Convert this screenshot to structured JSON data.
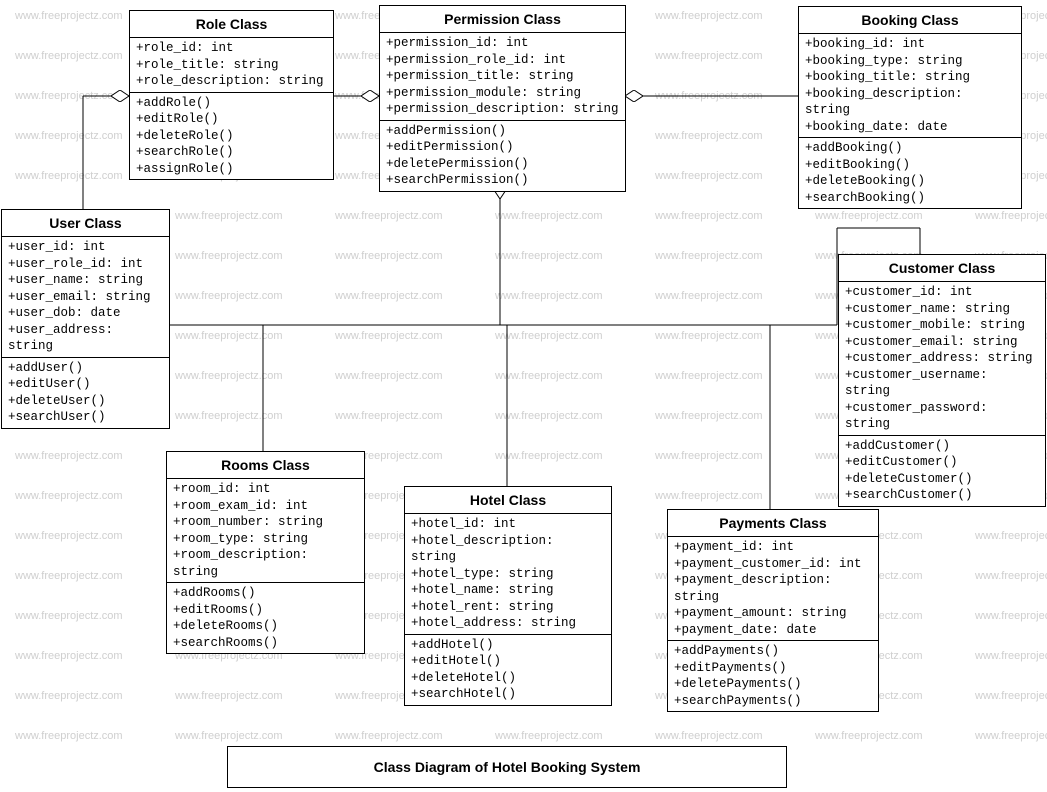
{
  "watermark_text": "www.freeprojectz.com",
  "caption": "Class Diagram of Hotel Booking System",
  "classes": {
    "permission": {
      "title": "Permission Class",
      "attrs": [
        "+permission_id: int",
        "+permission_role_id: int",
        "+permission_title: string",
        "+permission_module: string",
        "+permission_description: string"
      ],
      "ops": [
        "+addPermission()",
        "+editPermission()",
        "+deletePermission()",
        "+searchPermission()"
      ]
    },
    "role": {
      "title": "Role Class",
      "attrs": [
        "+role_id: int",
        "+role_title: string",
        "+role_description: string"
      ],
      "ops": [
        "+addRole()",
        "+editRole()",
        "+deleteRole()",
        "+searchRole()",
        "+assignRole()"
      ]
    },
    "booking": {
      "title": "Booking Class",
      "attrs": [
        "+booking_id: int",
        "+booking_type: string",
        "+booking_title: string",
        "+booking_description: string",
        "+booking_date: date"
      ],
      "ops": [
        "+addBooking()",
        "+editBooking()",
        "+deleteBooking()",
        "+searchBooking()"
      ]
    },
    "user": {
      "title": "User Class",
      "attrs": [
        "+user_id: int",
        "+user_role_id: int",
        "+user_name: string",
        "+user_email: string",
        "+user_dob: date",
        "+user_address: string"
      ],
      "ops": [
        "+addUser()",
        "+editUser()",
        "+deleteUser()",
        "+searchUser()"
      ]
    },
    "customer": {
      "title": "Customer Class",
      "attrs": [
        "+customer_id: int",
        "+customer_name: string",
        "+customer_mobile: string",
        "+customer_email: string",
        "+customer_address: string",
        "+customer_username: string",
        "+customer_password: string"
      ],
      "ops": [
        "+addCustomer()",
        "+editCustomer()",
        "+deleteCustomer()",
        "+searchCustomer()"
      ]
    },
    "rooms": {
      "title": "Rooms Class",
      "attrs": [
        "+room_id: int",
        "+room_exam_id: int",
        "+room_number: string",
        "+room_type: string",
        "+room_description: string"
      ],
      "ops": [
        "+addRooms()",
        "+editRooms()",
        "+deleteRooms()",
        "+searchRooms()"
      ]
    },
    "hotel": {
      "title": "Hotel Class",
      "attrs": [
        "+hotel_id: int",
        "+hotel_description: string",
        "+hotel_type: string",
        "+hotel_name: string",
        "+hotel_rent: string",
        "+hotel_address: string"
      ],
      "ops": [
        "+addHotel()",
        "+editHotel()",
        "+deleteHotel()",
        "+searchHotel()"
      ]
    },
    "payments": {
      "title": "Payments Class",
      "attrs": [
        "+payment_id: int",
        "+payment_customer_id: int",
        "+payment_description: string",
        "+payment_amount: string",
        "+payment_date: date"
      ],
      "ops": [
        "+addPayments()",
        "+editPayments()",
        "+deletePayments()",
        "+searchPayments()"
      ]
    }
  }
}
